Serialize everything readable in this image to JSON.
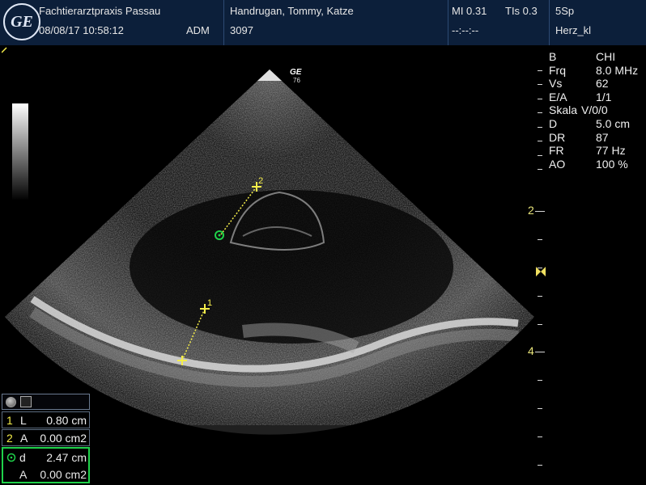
{
  "header": {
    "logo_text": "GE",
    "clinic": "Fachtierarztpraxis Passau",
    "datetime": "08/08/17 10:58:12",
    "operator": "ADM",
    "patient": "Handrugan, Tommy, Katze",
    "patient_id": "3097",
    "mi": "MI 0.31",
    "tis": "TIs 0.3",
    "time_placeholder": "--:--:--",
    "probe": "5Sp",
    "preset": "Herz_kl"
  },
  "probe_marker": {
    "brand": "GE",
    "frame_count": "76"
  },
  "params": [
    {
      "key": "B",
      "value": "CHI"
    },
    {
      "key": "Frq",
      "value": "8.0 MHz"
    },
    {
      "key": "Vs",
      "value": "62"
    },
    {
      "key": "E/A",
      "value": "1/1"
    },
    {
      "key": "Skala",
      "value": "V/0/0"
    },
    {
      "key": "D",
      "value": "5.0 cm"
    },
    {
      "key": "DR",
      "value": "87"
    },
    {
      "key": "FR",
      "value": "77 Hz"
    },
    {
      "key": "AO",
      "value": "100 %"
    }
  ],
  "depth_labels": [
    "2",
    "4"
  ],
  "measurements": [
    {
      "index": "1",
      "type": "L",
      "value": "0.80 cm"
    },
    {
      "index": "2",
      "type": "A",
      "value": "0.00 cm2"
    },
    {
      "index": "",
      "type": "d",
      "value": "2.47 cm"
    },
    {
      "index": "",
      "type": "A",
      "value": "0.00 cm2"
    }
  ],
  "markers": {
    "caliper_1": "1",
    "caliper_2": "2"
  },
  "colors": {
    "header_bg": "#0c1f3a",
    "caliper": "#f5ee4a",
    "active_measure": "#1fd24a"
  }
}
